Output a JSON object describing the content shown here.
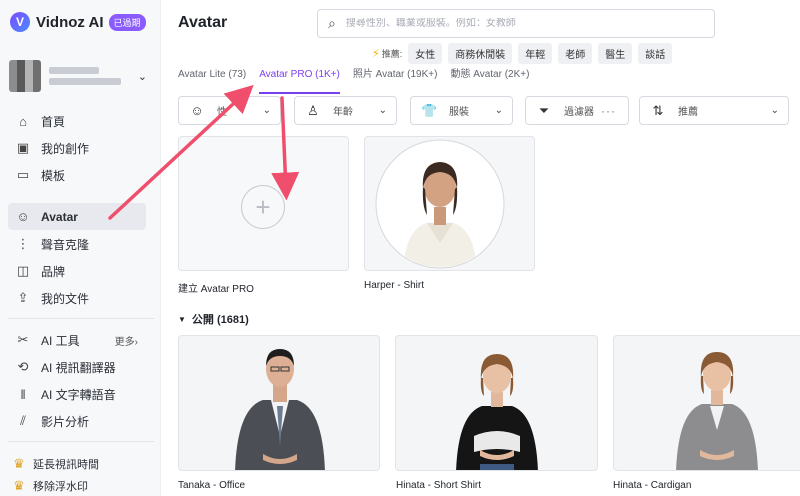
{
  "brand": {
    "name": "Vidnoz AI",
    "badge": "已過期"
  },
  "sidebar": {
    "nav": [
      {
        "label": "首頁",
        "icon": "home-icon"
      },
      {
        "label": "我的創作",
        "icon": "video-icon"
      },
      {
        "label": "模板",
        "icon": "template-icon"
      },
      {
        "label": "Avatar",
        "icon": "avatar-icon"
      },
      {
        "label": "聲音克隆",
        "icon": "voice-icon"
      },
      {
        "label": "品牌",
        "icon": "brand-icon"
      },
      {
        "label": "我的文件",
        "icon": "upload-icon"
      }
    ],
    "tools_label": "AI 工具",
    "more_label": "更多",
    "tools": [
      {
        "label": "AI 視訊翻譯器",
        "icon": "translate-icon"
      },
      {
        "label": "AI 文字轉語音",
        "icon": "audio-wave-icon"
      },
      {
        "label": "影片分析",
        "icon": "analytics-icon"
      }
    ],
    "promos": [
      {
        "label": "延長視訊時間",
        "icon": "crown-icon"
      },
      {
        "label": "移除浮水印",
        "icon": "crown-icon"
      }
    ]
  },
  "header": {
    "title": "Avatar",
    "search_placeholder": "搜尋性別、職業或服裝。例如：女教師",
    "recommend_label": "推薦:",
    "chips": [
      "女性",
      "商務休閒裝",
      "年輕",
      "老師",
      "醫生",
      "談話"
    ]
  },
  "tabs": [
    "Avatar Lite (73)",
    "Avatar PRO (1K+)",
    "照片 Avatar (19K+)",
    "動態 Avatar (2K+)"
  ],
  "filters": {
    "gender": "性",
    "age": "年齡",
    "clothing": "服裝",
    "filter": "過濾器",
    "sort": "推薦"
  },
  "pro_cards": [
    {
      "name": "建立 Avatar PRO"
    },
    {
      "name": "Harper - Shirt"
    }
  ],
  "public_section": "公開 (1681)",
  "public_cards": [
    {
      "name": "Tanaka - Office"
    },
    {
      "name": "Hinata - Short Shirt"
    },
    {
      "name": "Hinata - Cardigan"
    }
  ],
  "colors": {
    "accent": "#7b3ff2",
    "arrow": "#ef4f6c"
  }
}
